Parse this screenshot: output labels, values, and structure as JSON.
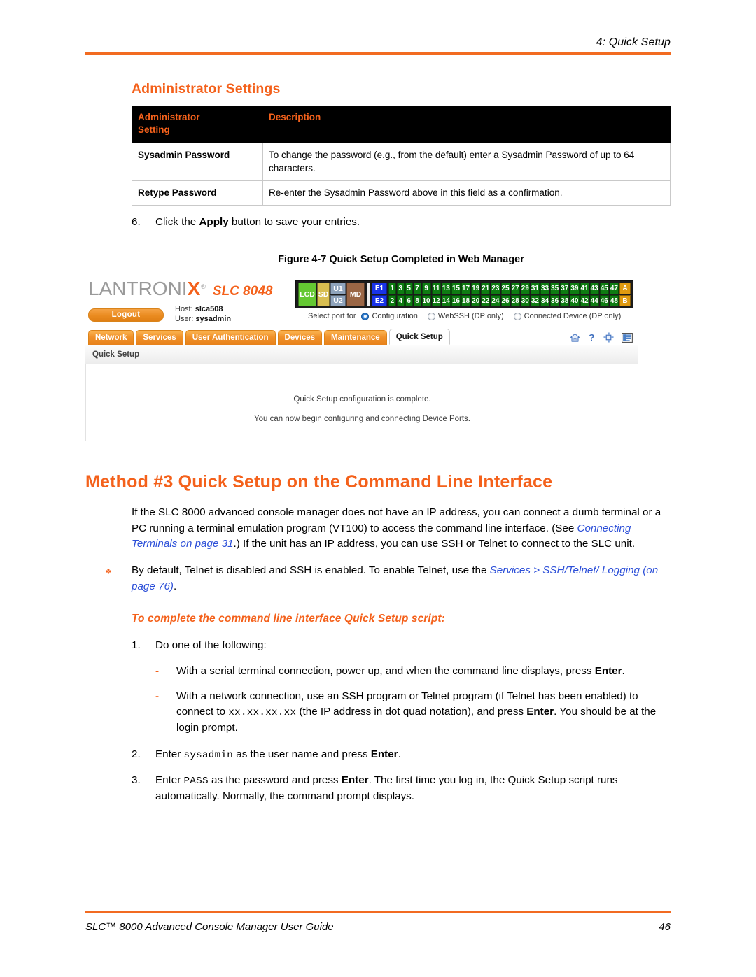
{
  "header": {
    "running_head": "4: Quick Setup"
  },
  "section": {
    "title": "Administrator Settings"
  },
  "settings_table": {
    "headers": [
      "Administrator Setting",
      "Description"
    ],
    "header_col1_line1": "Administrator",
    "header_col1_line2": "Setting",
    "header_col2": "Description",
    "rows": [
      {
        "setting": "Sysadmin Password",
        "description": "To change the password (e.g., from the default) enter a Sysadmin Password of up to 64 characters."
      },
      {
        "setting": "Retype Password",
        "description": "Re-enter the Sysadmin Password above in this field as a confirmation."
      }
    ]
  },
  "step6": {
    "num": "6.",
    "text_before": "Click the ",
    "bold": "Apply",
    "text_after": " button to save your entries."
  },
  "figure": {
    "caption": "Figure 4-7  Quick Setup Completed in Web Manager",
    "web_manager": {
      "logo": "LANTRONI",
      "logo_x": "X",
      "logo_reg": "®",
      "model": "SLC 8048",
      "logout_label": "Logout",
      "host_label": "Host:",
      "host_value": "slca508",
      "user_label": "User:",
      "user_value": "sysadmin",
      "port_panel": {
        "left_cells": [
          "LCD",
          "SD"
        ],
        "stack_cells": [
          "U1",
          "U2"
        ],
        "md_cell": "MD",
        "ethernet": [
          "E1",
          "E2"
        ],
        "top_ports": [
          "1",
          "3",
          "5",
          "7",
          "9",
          "11",
          "13",
          "15",
          "17",
          "19",
          "21",
          "23",
          "25",
          "27",
          "29",
          "31",
          "33",
          "35",
          "37",
          "39",
          "41",
          "43",
          "45",
          "47"
        ],
        "bottom_ports": [
          "2",
          "4",
          "6",
          "8",
          "10",
          "12",
          "14",
          "16",
          "18",
          "20",
          "22",
          "24",
          "26",
          "28",
          "30",
          "32",
          "34",
          "36",
          "38",
          "40",
          "42",
          "44",
          "46",
          "48"
        ],
        "ab_cells": [
          "A",
          "B"
        ],
        "colors": {
          "lcd": "#64C832",
          "sd": "#D8BE50",
          "u": "#8FA4BC",
          "md": "#9A6645",
          "ethernet": "#1933E8",
          "port": "#0E7C12",
          "ab": "#E09A10",
          "panel_bg": "#1b1b1b"
        }
      },
      "select_port": {
        "label": "Select port for",
        "options": [
          {
            "label": "Configuration",
            "selected": true
          },
          {
            "label": "WebSSH (DP only)",
            "selected": false
          },
          {
            "label": "Connected Device (DP only)",
            "selected": false
          }
        ]
      },
      "tabs": [
        {
          "label": "Network",
          "active": false
        },
        {
          "label": "Services",
          "active": false
        },
        {
          "label": "User Authentication",
          "active": false
        },
        {
          "label": "Devices",
          "active": false
        },
        {
          "label": "Maintenance",
          "active": false
        },
        {
          "label": "Quick Setup",
          "active": true
        }
      ],
      "toolbar_icons": [
        "home-icon",
        "help-icon",
        "expand-icon",
        "logs-icon"
      ],
      "subbar_title": "Quick Setup",
      "messages": [
        "Quick Setup configuration is complete.",
        "You can now begin configuring and connecting Device Ports."
      ],
      "accent": "#F4611B"
    }
  },
  "chapter": {
    "title": "Method #3 Quick Setup on the Command Line Interface",
    "intro_1": "If the SLC 8000 advanced console manager does not have an IP address, you can connect a dumb terminal or a PC running a terminal emulation program (VT100) to access the command line interface. (See ",
    "intro_xref": "Connecting Terminals on page 31",
    "intro_2": ".) If the unit has an IP address, you can use SSH or Telnet to connect to the SLC unit."
  },
  "bullet": {
    "marker": "❖",
    "text_1": "By default, Telnet is disabled and SSH is enabled. To enable Telnet, use the ",
    "xref": "Services > SSH/Telnet/ Logging (on page 76)",
    "text_2": "."
  },
  "procedure": {
    "title": "To complete the command line interface Quick Setup script:",
    "steps": [
      {
        "num": "1.",
        "text": "Do one of the following:",
        "substeps": [
          {
            "marker": "-",
            "parts": [
              {
                "type": "text",
                "value": "With a serial terminal connection, power up, and when the command line displays, press "
              },
              {
                "type": "bold",
                "value": "Enter"
              },
              {
                "type": "text",
                "value": "."
              }
            ]
          },
          {
            "marker": "-",
            "parts": [
              {
                "type": "text",
                "value": "With a network connection, use an SSH program or Telnet program (if Telnet has been enabled) to connect to "
              },
              {
                "type": "mono",
                "value": "xx.xx.xx.xx"
              },
              {
                "type": "text",
                "value": " (the IP address in dot quad notation), and press "
              },
              {
                "type": "bold",
                "value": "Enter"
              },
              {
                "type": "text",
                "value": ". You should be at the login prompt."
              }
            ]
          }
        ]
      },
      {
        "num": "2.",
        "parts": [
          {
            "type": "text",
            "value": "Enter "
          },
          {
            "type": "mono",
            "value": "sysadmin"
          },
          {
            "type": "text",
            "value": " as the user name and press "
          },
          {
            "type": "bold",
            "value": "Enter"
          },
          {
            "type": "text",
            "value": "."
          }
        ],
        "substeps": []
      },
      {
        "num": "3.",
        "parts": [
          {
            "type": "text",
            "value": "Enter "
          },
          {
            "type": "mono",
            "value": "PASS"
          },
          {
            "type": "text",
            "value": " as the password and press "
          },
          {
            "type": "bold",
            "value": "Enter"
          },
          {
            "type": "text",
            "value": ". The first time you log in, the Quick Setup script runs automatically. Normally, the command prompt displays."
          }
        ],
        "substeps": []
      }
    ]
  },
  "footer": {
    "left": "SLC™ 8000 Advanced Console Manager User Guide",
    "page": "46"
  }
}
